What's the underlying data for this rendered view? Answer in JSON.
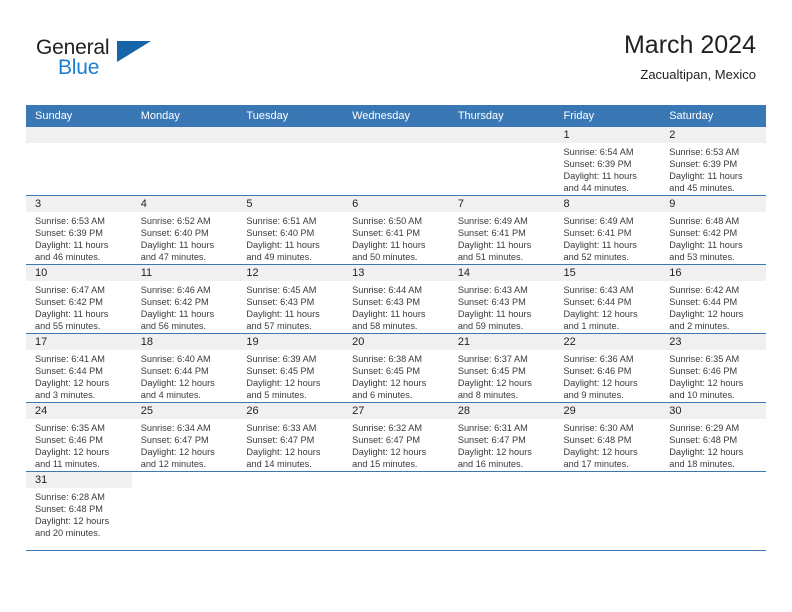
{
  "brand": {
    "name_top": "General",
    "name_bottom": "Blue",
    "accent_color": "#1565a8",
    "text_color": "#231f20"
  },
  "header": {
    "title": "March 2024",
    "subtitle": "Zacualtipan, Mexico",
    "header_bar_color": "#3a78b5",
    "daynum_strip_color": "#f0f0f0"
  },
  "weekday_headers": [
    "Sunday",
    "Monday",
    "Tuesday",
    "Wednesday",
    "Thursday",
    "Friday",
    "Saturday"
  ],
  "weeks": [
    [
      {
        "day": "",
        "sunrise": "",
        "sunset": "",
        "daylight_line1": "",
        "daylight_line2": ""
      },
      {
        "day": "",
        "sunrise": "",
        "sunset": "",
        "daylight_line1": "",
        "daylight_line2": ""
      },
      {
        "day": "",
        "sunrise": "",
        "sunset": "",
        "daylight_line1": "",
        "daylight_line2": ""
      },
      {
        "day": "",
        "sunrise": "",
        "sunset": "",
        "daylight_line1": "",
        "daylight_line2": ""
      },
      {
        "day": "",
        "sunrise": "",
        "sunset": "",
        "daylight_line1": "",
        "daylight_line2": ""
      },
      {
        "day": "1",
        "sunrise": "Sunrise: 6:54 AM",
        "sunset": "Sunset: 6:39 PM",
        "daylight_line1": "Daylight: 11 hours",
        "daylight_line2": "and 44 minutes."
      },
      {
        "day": "2",
        "sunrise": "Sunrise: 6:53 AM",
        "sunset": "Sunset: 6:39 PM",
        "daylight_line1": "Daylight: 11 hours",
        "daylight_line2": "and 45 minutes."
      }
    ],
    [
      {
        "day": "3",
        "sunrise": "Sunrise: 6:53 AM",
        "sunset": "Sunset: 6:39 PM",
        "daylight_line1": "Daylight: 11 hours",
        "daylight_line2": "and 46 minutes."
      },
      {
        "day": "4",
        "sunrise": "Sunrise: 6:52 AM",
        "sunset": "Sunset: 6:40 PM",
        "daylight_line1": "Daylight: 11 hours",
        "daylight_line2": "and 47 minutes."
      },
      {
        "day": "5",
        "sunrise": "Sunrise: 6:51 AM",
        "sunset": "Sunset: 6:40 PM",
        "daylight_line1": "Daylight: 11 hours",
        "daylight_line2": "and 49 minutes."
      },
      {
        "day": "6",
        "sunrise": "Sunrise: 6:50 AM",
        "sunset": "Sunset: 6:41 PM",
        "daylight_line1": "Daylight: 11 hours",
        "daylight_line2": "and 50 minutes."
      },
      {
        "day": "7",
        "sunrise": "Sunrise: 6:49 AM",
        "sunset": "Sunset: 6:41 PM",
        "daylight_line1": "Daylight: 11 hours",
        "daylight_line2": "and 51 minutes."
      },
      {
        "day": "8",
        "sunrise": "Sunrise: 6:49 AM",
        "sunset": "Sunset: 6:41 PM",
        "daylight_line1": "Daylight: 11 hours",
        "daylight_line2": "and 52 minutes."
      },
      {
        "day": "9",
        "sunrise": "Sunrise: 6:48 AM",
        "sunset": "Sunset: 6:42 PM",
        "daylight_line1": "Daylight: 11 hours",
        "daylight_line2": "and 53 minutes."
      }
    ],
    [
      {
        "day": "10",
        "sunrise": "Sunrise: 6:47 AM",
        "sunset": "Sunset: 6:42 PM",
        "daylight_line1": "Daylight: 11 hours",
        "daylight_line2": "and 55 minutes."
      },
      {
        "day": "11",
        "sunrise": "Sunrise: 6:46 AM",
        "sunset": "Sunset: 6:42 PM",
        "daylight_line1": "Daylight: 11 hours",
        "daylight_line2": "and 56 minutes."
      },
      {
        "day": "12",
        "sunrise": "Sunrise: 6:45 AM",
        "sunset": "Sunset: 6:43 PM",
        "daylight_line1": "Daylight: 11 hours",
        "daylight_line2": "and 57 minutes."
      },
      {
        "day": "13",
        "sunrise": "Sunrise: 6:44 AM",
        "sunset": "Sunset: 6:43 PM",
        "daylight_line1": "Daylight: 11 hours",
        "daylight_line2": "and 58 minutes."
      },
      {
        "day": "14",
        "sunrise": "Sunrise: 6:43 AM",
        "sunset": "Sunset: 6:43 PM",
        "daylight_line1": "Daylight: 11 hours",
        "daylight_line2": "and 59 minutes."
      },
      {
        "day": "15",
        "sunrise": "Sunrise: 6:43 AM",
        "sunset": "Sunset: 6:44 PM",
        "daylight_line1": "Daylight: 12 hours",
        "daylight_line2": "and 1 minute."
      },
      {
        "day": "16",
        "sunrise": "Sunrise: 6:42 AM",
        "sunset": "Sunset: 6:44 PM",
        "daylight_line1": "Daylight: 12 hours",
        "daylight_line2": "and 2 minutes."
      }
    ],
    [
      {
        "day": "17",
        "sunrise": "Sunrise: 6:41 AM",
        "sunset": "Sunset: 6:44 PM",
        "daylight_line1": "Daylight: 12 hours",
        "daylight_line2": "and 3 minutes."
      },
      {
        "day": "18",
        "sunrise": "Sunrise: 6:40 AM",
        "sunset": "Sunset: 6:44 PM",
        "daylight_line1": "Daylight: 12 hours",
        "daylight_line2": "and 4 minutes."
      },
      {
        "day": "19",
        "sunrise": "Sunrise: 6:39 AM",
        "sunset": "Sunset: 6:45 PM",
        "daylight_line1": "Daylight: 12 hours",
        "daylight_line2": "and 5 minutes."
      },
      {
        "day": "20",
        "sunrise": "Sunrise: 6:38 AM",
        "sunset": "Sunset: 6:45 PM",
        "daylight_line1": "Daylight: 12 hours",
        "daylight_line2": "and 6 minutes."
      },
      {
        "day": "21",
        "sunrise": "Sunrise: 6:37 AM",
        "sunset": "Sunset: 6:45 PM",
        "daylight_line1": "Daylight: 12 hours",
        "daylight_line2": "and 8 minutes."
      },
      {
        "day": "22",
        "sunrise": "Sunrise: 6:36 AM",
        "sunset": "Sunset: 6:46 PM",
        "daylight_line1": "Daylight: 12 hours",
        "daylight_line2": "and 9 minutes."
      },
      {
        "day": "23",
        "sunrise": "Sunrise: 6:35 AM",
        "sunset": "Sunset: 6:46 PM",
        "daylight_line1": "Daylight: 12 hours",
        "daylight_line2": "and 10 minutes."
      }
    ],
    [
      {
        "day": "24",
        "sunrise": "Sunrise: 6:35 AM",
        "sunset": "Sunset: 6:46 PM",
        "daylight_line1": "Daylight: 12 hours",
        "daylight_line2": "and 11 minutes."
      },
      {
        "day": "25",
        "sunrise": "Sunrise: 6:34 AM",
        "sunset": "Sunset: 6:47 PM",
        "daylight_line1": "Daylight: 12 hours",
        "daylight_line2": "and 12 minutes."
      },
      {
        "day": "26",
        "sunrise": "Sunrise: 6:33 AM",
        "sunset": "Sunset: 6:47 PM",
        "daylight_line1": "Daylight: 12 hours",
        "daylight_line2": "and 14 minutes."
      },
      {
        "day": "27",
        "sunrise": "Sunrise: 6:32 AM",
        "sunset": "Sunset: 6:47 PM",
        "daylight_line1": "Daylight: 12 hours",
        "daylight_line2": "and 15 minutes."
      },
      {
        "day": "28",
        "sunrise": "Sunrise: 6:31 AM",
        "sunset": "Sunset: 6:47 PM",
        "daylight_line1": "Daylight: 12 hours",
        "daylight_line2": "and 16 minutes."
      },
      {
        "day": "29",
        "sunrise": "Sunrise: 6:30 AM",
        "sunset": "Sunset: 6:48 PM",
        "daylight_line1": "Daylight: 12 hours",
        "daylight_line2": "and 17 minutes."
      },
      {
        "day": "30",
        "sunrise": "Sunrise: 6:29 AM",
        "sunset": "Sunset: 6:48 PM",
        "daylight_line1": "Daylight: 12 hours",
        "daylight_line2": "and 18 minutes."
      }
    ],
    [
      {
        "day": "31",
        "sunrise": "Sunrise: 6:28 AM",
        "sunset": "Sunset: 6:48 PM",
        "daylight_line1": "Daylight: 12 hours",
        "daylight_line2": "and 20 minutes."
      },
      {
        "day": "",
        "sunrise": "",
        "sunset": "",
        "daylight_line1": "",
        "daylight_line2": ""
      },
      {
        "day": "",
        "sunrise": "",
        "sunset": "",
        "daylight_line1": "",
        "daylight_line2": ""
      },
      {
        "day": "",
        "sunrise": "",
        "sunset": "",
        "daylight_line1": "",
        "daylight_line2": ""
      },
      {
        "day": "",
        "sunrise": "",
        "sunset": "",
        "daylight_line1": "",
        "daylight_line2": ""
      },
      {
        "day": "",
        "sunrise": "",
        "sunset": "",
        "daylight_line1": "",
        "daylight_line2": ""
      },
      {
        "day": "",
        "sunrise": "",
        "sunset": "",
        "daylight_line1": "",
        "daylight_line2": ""
      }
    ]
  ]
}
